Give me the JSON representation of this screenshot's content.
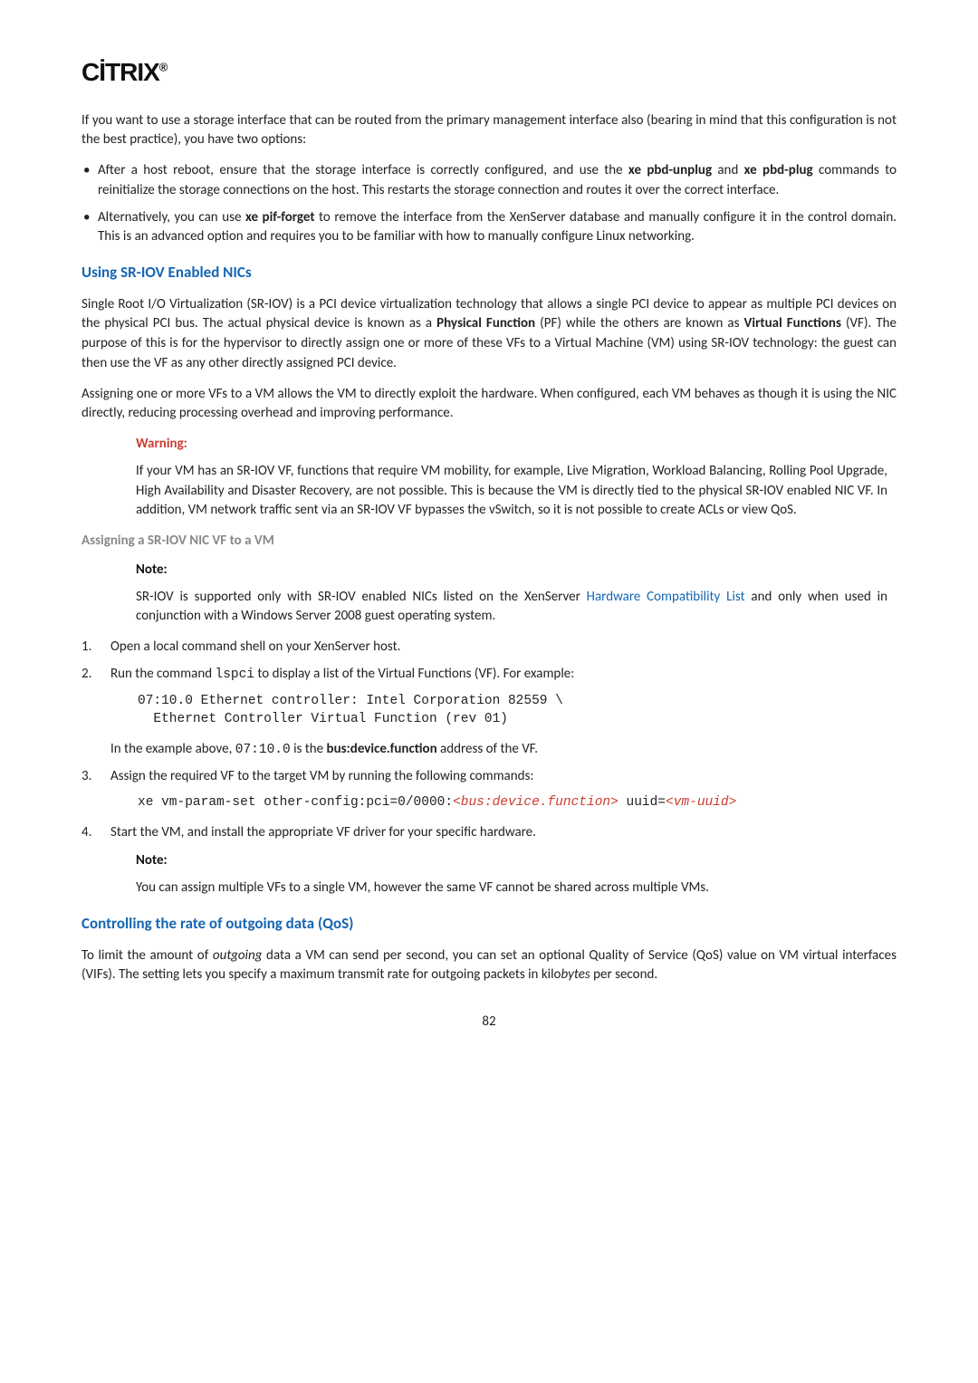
{
  "logo": {
    "text": "CİTRIX",
    "dot": "®"
  },
  "intro_p1": "If you want to use a storage interface that can be routed from the primary management interface also (bearing in mind that this configuration is not the best practice), you have two options:",
  "bullets": [
    {
      "pre1": "After a host reboot, ensure that the storage interface is correctly configured, and use the ",
      "b1": "xe pbd-unplug",
      "mid1": " and ",
      "b2": "xe pbd-plug",
      "post1": " commands to reinitialize the storage connections on the host. This restarts the storage connection and routes it over the correct interface."
    },
    {
      "pre1": "Alternatively, you can use ",
      "b1": "xe pif-forget",
      "post1": " to remove the interface from the XenServer database and manually configure it in the control domain. This is an advanced option and requires you to be familiar with how to manually configure Linux networking."
    }
  ],
  "sriov": {
    "heading": "Using SR-IOV Enabled NICs",
    "p1_a": "Single Root I/O Virtualization (SR-IOV) is a PCI device virtualization technology that allows a single PCI device to appear as multiple PCI devices on the physical PCI bus. The actual physical device is known as a ",
    "p1_b1": "Physical Function",
    "p1_b": " (PF) while the others are known as ",
    "p1_b2": "Virtual Functions",
    "p1_c": " (VF). The purpose of this is for the hypervisor to directly assign one or more of these VFs to a Virtual Machine (VM) using SR-IOV technology: the guest can then use the VF as any other directly assigned PCI device.",
    "p2": "Assigning one or more VFs to a VM allows the VM to directly exploit the hardware. When configured, each VM behaves as though it is using the NIC directly, reducing processing overhead and improving performance.",
    "warning_title": "Warning:",
    "warning_body": "If your VM has an SR-IOV VF, functions that require VM mobility, for example, Live Migration, Workload Balancing, Rolling Pool Upgrade, High Availability and Disaster Recovery, are not possible. This is because the VM is directly tied to the physical SR-IOV enabled NIC VF. In addition, VM network traffic sent via an SR-IOV VF bypasses the vSwitch, so it is not possible to create ACLs or view QoS.",
    "assign_heading": "Assigning a SR-IOV NIC VF to a VM",
    "note1_title": "Note:",
    "note1_a": "SR-IOV is supported only with SR-IOV enabled NICs listed on the XenServer ",
    "note1_link": "Hardware Compatibility List",
    "note1_b": " and only when used in conjunction with a Windows Server 2008 guest operating system.",
    "step1": "Open a local command shell on your XenServer host.",
    "step2_a": "Run the command ",
    "step2_code": "lspci",
    "step2_b": " to display a list of the Virtual Functions (VF). For example:",
    "code_block1": "07:10.0 Ethernet controller: Intel Corporation 82559 \\\n  Ethernet Controller Virtual Function (rev 01)",
    "step2_post_a": "In the example above, ",
    "step2_post_code": "07:10.0",
    "step2_post_b": " is the ",
    "step2_post_bold": "bus:device.function",
    "step2_post_c": " address of the VF.",
    "step3": "Assign the required VF to the target VM by running the following commands:",
    "code_block2_a": "xe vm-param-set other-config:pci=0/0000:",
    "code_block2_b": "<bus:device.function>",
    "code_block2_c": " uuid=",
    "code_block2_d": "<vm-uuid>",
    "step4": "Start the VM, and install the appropriate VF driver for your specific hardware.",
    "note2_title": "Note:",
    "note2_body": "You can assign multiple VFs to a single VM, however the same VF cannot be shared across multiple VMs."
  },
  "qos": {
    "heading": "Controlling the rate of outgoing data (QoS)",
    "p1_a": "To limit the amount of ",
    "p1_i": "outgoing",
    "p1_b": " data a VM can send per second, you can set an optional Quality of Service (QoS) value on VM virtual interfaces (VIFs). The setting lets you specify a maximum transmit rate for outgoing packets in kilo",
    "p1_i2": "bytes",
    "p1_c": " per second."
  },
  "page_number": "82"
}
